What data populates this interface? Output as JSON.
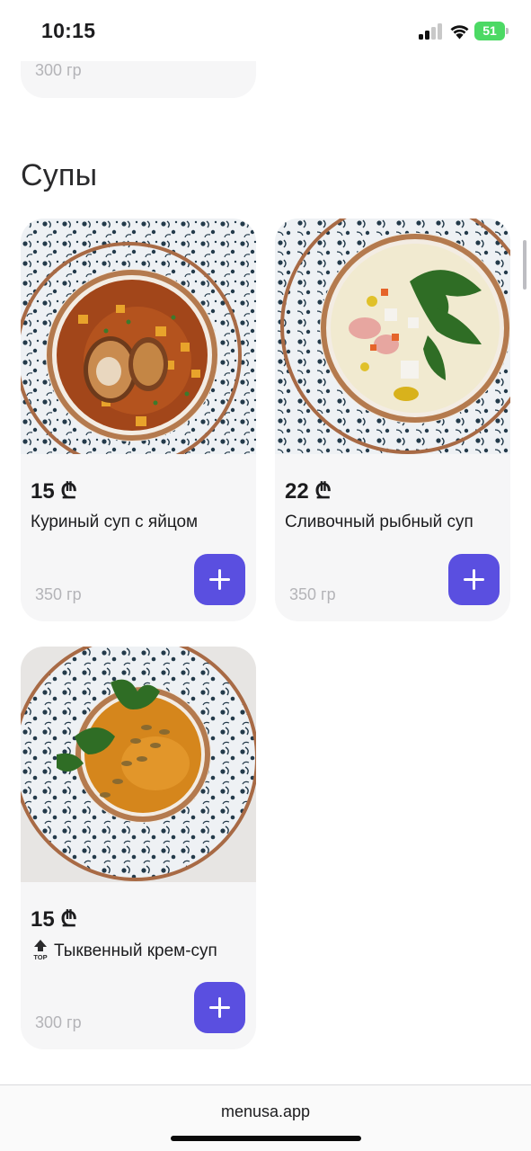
{
  "status_bar": {
    "time": "10:15",
    "battery": "51"
  },
  "previous_item": {
    "weight": "300 гр"
  },
  "section": {
    "title": "Супы"
  },
  "products": [
    {
      "price": "15 ₾",
      "name": "Куриный суп с яйцом",
      "weight": "350 гр",
      "top": false
    },
    {
      "price": "22 ₾",
      "name": "Сливочный рыбный суп",
      "weight": "350 гр",
      "top": false
    },
    {
      "price": "15 ₾",
      "name": "Тыквенный крем-суп",
      "weight": "300 гр",
      "top": true,
      "badge": "TOP"
    }
  ],
  "footer": {
    "url": "menusa.app"
  },
  "colors": {
    "accent": "#5a4fe0",
    "card_bg": "#f6f6f7",
    "muted_text": "#b4b4b8",
    "battery": "#4cd964"
  },
  "icons": [
    "cellular-signal-icon",
    "wifi-icon",
    "battery-icon",
    "plus-icon",
    "top-arrow-icon"
  ]
}
